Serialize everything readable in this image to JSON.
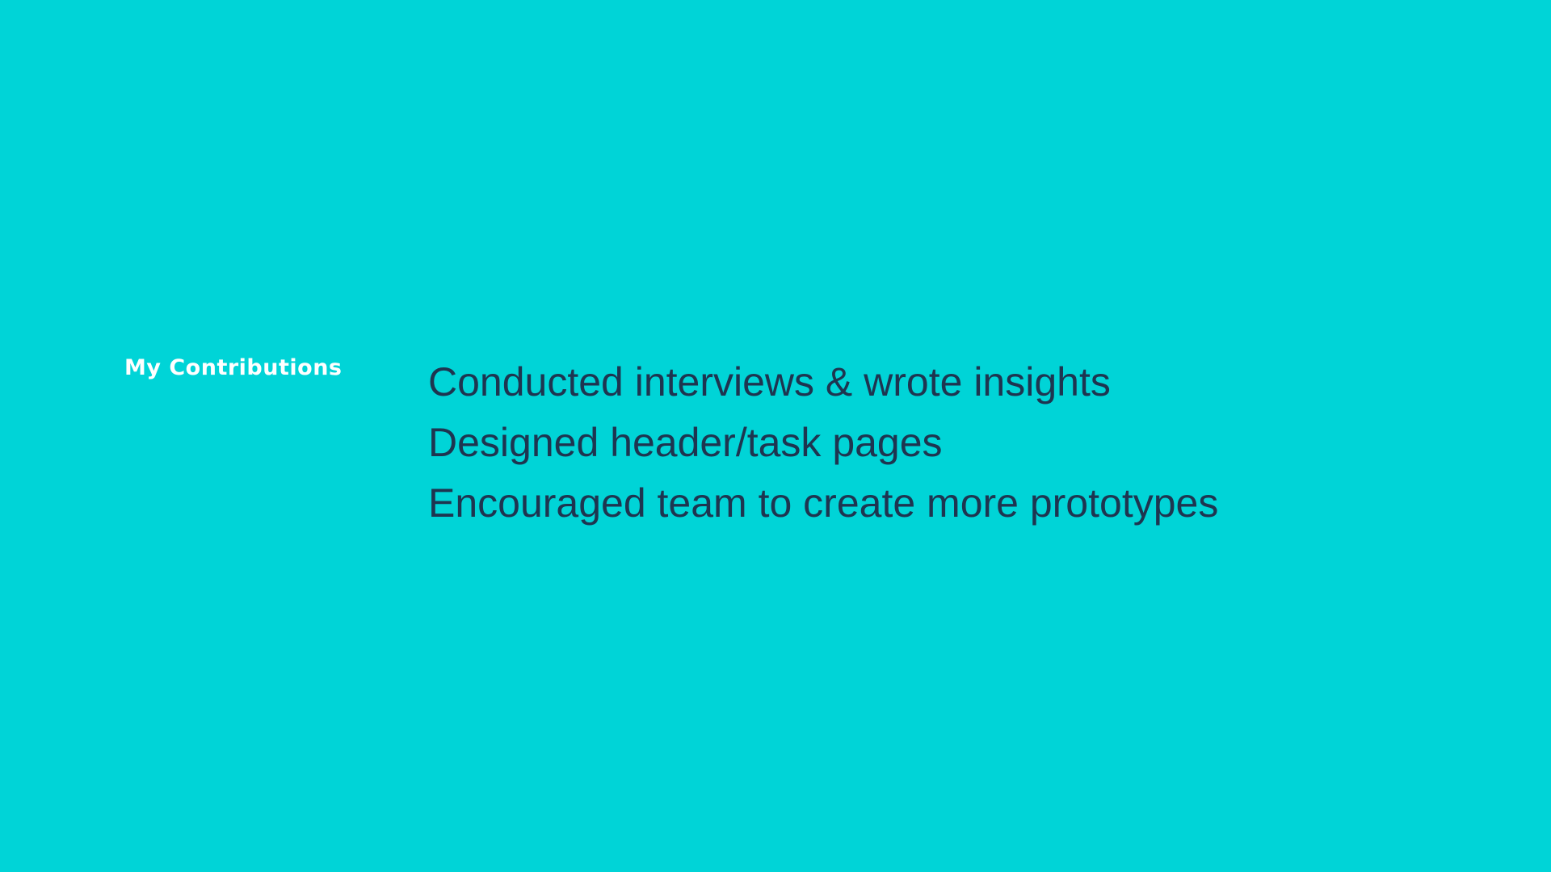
{
  "colors": {
    "background": "#00D4D7",
    "label_text": "#FFFFFF",
    "item_text": "#1E3550"
  },
  "section": {
    "label": "My Contributions",
    "items": [
      "Conducted interviews & wrote insights",
      "Designed header/task pages",
      "Encouraged team to create more prototypes"
    ]
  }
}
